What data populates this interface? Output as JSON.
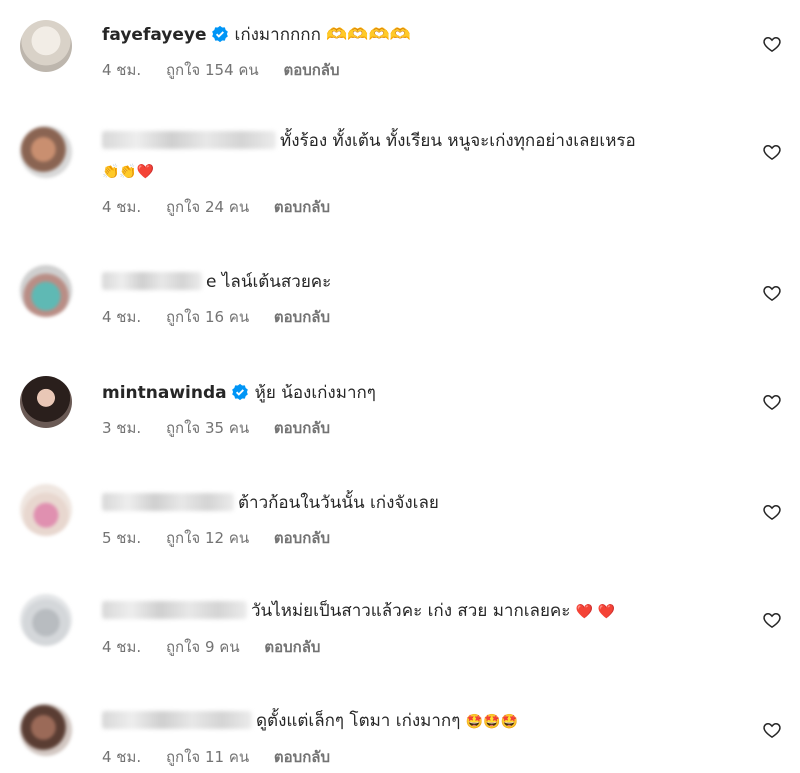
{
  "comments": [
    {
      "username": "fayefayeye",
      "verified": true,
      "text": "เก่งมากกกก 🫶🫶🫶🫶",
      "time": "4 ชม.",
      "likes": "ถูกใจ 154 คน",
      "reply": "ตอบกลับ"
    },
    {
      "username": "",
      "verified": false,
      "text": "ทั้งร้อง ทั้งเต้น ทั้งเรียน หนูจะเก่งทุกอย่างเลยเหรอ",
      "emojis": "👏👏❤️",
      "time": "4 ชม.",
      "likes": "ถูกใจ 24 คน",
      "reply": "ตอบกลับ"
    },
    {
      "username": "",
      "verified": false,
      "text": "e ไลน์เต้นสวยคะ",
      "time": "4 ชม.",
      "likes": "ถูกใจ 16 คน",
      "reply": "ตอบกลับ"
    },
    {
      "username": "mintnawinda",
      "verified": true,
      "text": "หู้ย น้องเก่งมากๆ",
      "time": "3 ชม.",
      "likes": "ถูกใจ 35 คน",
      "reply": "ตอบกลับ"
    },
    {
      "username": "",
      "verified": false,
      "text": "ต้าวก้อนในวันนั้น เก่งจังเลย",
      "time": "5 ชม.",
      "likes": "ถูกใจ 12 คน",
      "reply": "ตอบกลับ"
    },
    {
      "username": "",
      "verified": false,
      "text": "วันไหม่ยเป็นสาวแล้วคะ เก่ง สวย มากเลยคะ",
      "emojis": "❤️ ❤️",
      "time": "4 ชม.",
      "likes": "ถูกใจ 9 คน",
      "reply": "ตอบกลับ"
    },
    {
      "username": "",
      "verified": false,
      "text": "ดูตั้งแต่เล็กๆ โตมา เก่งมากๆ",
      "emojis": "🤩🤩🤩",
      "time": "4 ชม.",
      "likes": "ถูกใจ 11 คน",
      "reply": "ตอบกลับ"
    }
  ],
  "icons": {
    "like": "heart-outline-icon",
    "verified": "verified-badge-icon"
  },
  "colors": {
    "verified": "#0095f6",
    "meta": "#737373",
    "text": "#262626",
    "emoji_red": "#e0245e"
  }
}
